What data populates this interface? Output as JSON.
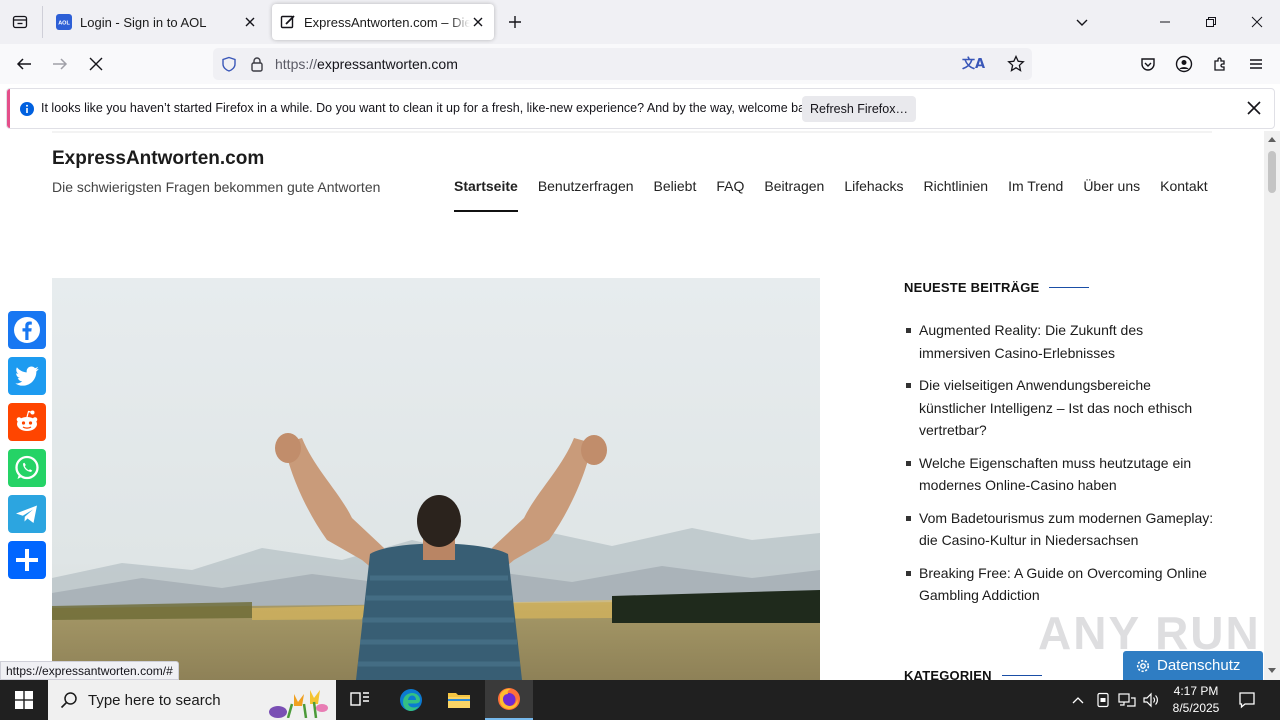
{
  "browser": {
    "tabs": [
      {
        "title": "Login - Sign in to AOL",
        "favicon_text": "AOL",
        "active": false
      },
      {
        "title": "ExpressAntworten.com – Die schwierigsten",
        "active": true
      }
    ],
    "url_protocol": "https://",
    "url_host": "expressantworten.com"
  },
  "notification": {
    "message": "It looks like you haven’t started Firefox in a while. Do you want to clean it up for a fresh, like-new experience? And by the way, welcome back!",
    "button_label": "Refresh Firefox…"
  },
  "site": {
    "title": "ExpressAntworten.com",
    "tagline": "Die schwierigsten Fragen bekommen gute Antworten",
    "nav": [
      "Startseite",
      "Benutzerfragen",
      "Beliebt",
      "FAQ",
      "Beitragen",
      "Lifehacks",
      "Richtlinien",
      "Im Trend",
      "Über uns",
      "Kontakt"
    ],
    "nav_current": "Startseite"
  },
  "sidebar": {
    "recent_heading": "NEUESTE BEITRÄGE",
    "recent_posts": [
      "Augmented Reality: Die Zukunft des immersiven Casino-Erlebnisses",
      "Die vielseitigen Anwendungsbereiche künstlicher Intelligenz – Ist das noch ethisch vertretbar?",
      "Welche Eigenschaften muss heutzutage ein modernes Online-Casino haben",
      "Vom Badetourismus zum modernen Gameplay: die Casino-Kultur in Niedersachsen",
      "Breaking Free: A Guide on Overcoming Online Gambling Addiction"
    ],
    "categories_heading": "KATEGORIEN"
  },
  "share_buttons": [
    {
      "name": "facebook",
      "color": "#1877f2"
    },
    {
      "name": "twitter",
      "color": "#1d9bf0"
    },
    {
      "name": "reddit",
      "color": "#ff4500"
    },
    {
      "name": "whatsapp",
      "color": "#25d366"
    },
    {
      "name": "telegram",
      "color": "#2ca5e0"
    },
    {
      "name": "share",
      "color": "#0166ff"
    }
  ],
  "status_url": "https://expressantworten.com/#",
  "privacy_label": "Datenschutz",
  "watermark": "ANY RUN",
  "taskbar": {
    "search_placeholder": "Type here to search",
    "time": "4:17 PM",
    "date": "8/5/2025"
  }
}
